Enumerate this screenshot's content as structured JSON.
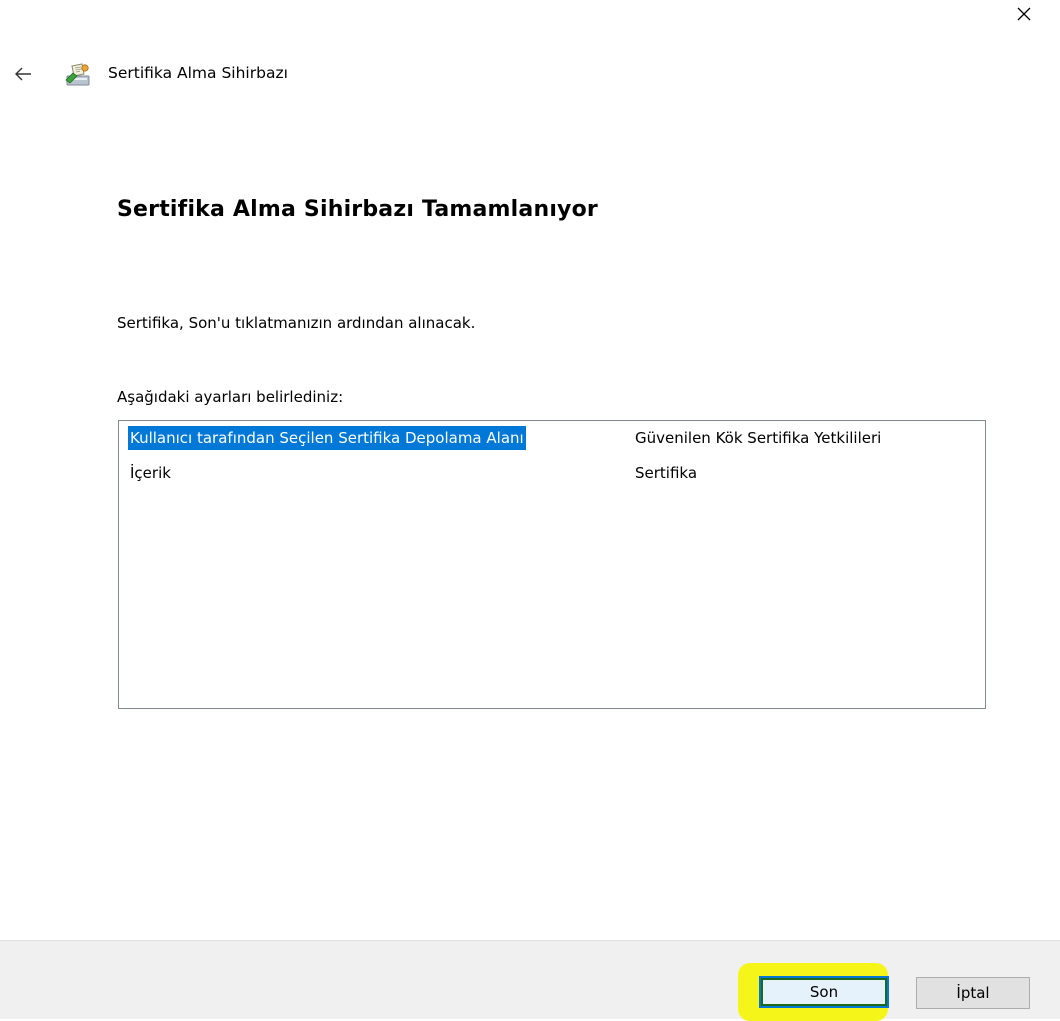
{
  "window": {
    "title": "Sertifika Alma Sihirbazı"
  },
  "icons": {
    "close": "close-icon",
    "back": "back-arrow-icon",
    "app": "certificate-wizard-icon"
  },
  "page": {
    "heading": "Sertifika Alma Sihirbazı Tamamlanıyor",
    "description": "Sertifika, Son'u tıklatmanızın ardından alınacak.",
    "list_label": "Aşağıdaki ayarları belirlediniz:"
  },
  "summary": {
    "rows": [
      {
        "key": "Kullanıcı tarafından Seçilen Sertifika Depolama Alanı",
        "value": "Güvenilen Kök Sertifika Yetkilileri",
        "selected": true
      },
      {
        "key": "İçerik",
        "value": "Sertifika",
        "selected": false
      }
    ]
  },
  "buttons": {
    "finish": "Son",
    "cancel": "İptal"
  },
  "colors": {
    "selection": "#0078d7",
    "highlight": "#f5f51a",
    "footer": "#f0f0f0"
  }
}
